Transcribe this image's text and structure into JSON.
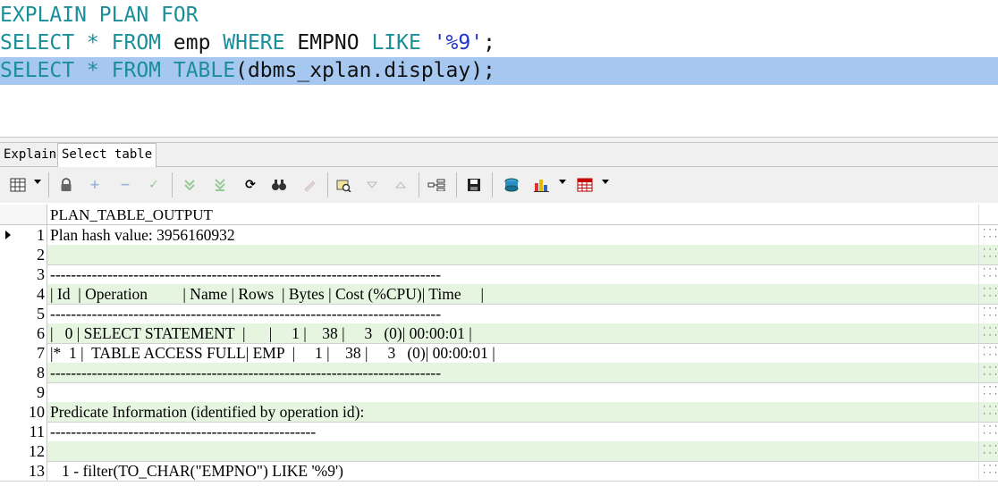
{
  "editor": {
    "lines": [
      {
        "segments": [
          {
            "t": "EXPLAIN PLAN FOR",
            "c": "kw"
          }
        ]
      },
      {
        "segments": [
          {
            "t": "SELECT * FROM ",
            "c": "kw"
          },
          {
            "t": "emp ",
            "c": "id"
          },
          {
            "t": "WHERE ",
            "c": "kw"
          },
          {
            "t": "EMPNO ",
            "c": "id"
          },
          {
            "t": "LIKE ",
            "c": "kw"
          },
          {
            "t": "'%9'",
            "c": "str"
          },
          {
            "t": ";",
            "c": "id"
          }
        ]
      },
      {
        "segments": [
          {
            "t": "SELECT * FROM TABLE",
            "c": "kw"
          },
          {
            "t": "(dbms_xplan.display);",
            "c": "id"
          }
        ],
        "selected": true
      }
    ]
  },
  "tabs": [
    {
      "label": "Explain",
      "active": false
    },
    {
      "label": "Select table",
      "active": true
    }
  ],
  "toolbar": {
    "icons": [
      "grid-view-icon",
      "lock-icon",
      "add-record-icon",
      "delete-record-icon",
      "post-changes-icon",
      "fetch-next-page-icon",
      "fetch-last-page-icon",
      "refresh-icon",
      "find-icon",
      "clear-icon",
      "query-by-example-icon",
      "filter-icon",
      "sort-icon",
      "single-record-view-icon",
      "save-icon",
      "export-icon",
      "chart-icon",
      "export-grid-icon"
    ]
  },
  "grid": {
    "column_header": "PLAN_TABLE_OUTPUT",
    "current_row": 1,
    "rows": [
      {
        "n": "1",
        "text": "Plan hash value: 3956160932"
      },
      {
        "n": "2",
        "text": ""
      },
      {
        "n": "3",
        "text": "---------------------------------------------------------------------------"
      },
      {
        "n": "4",
        "text": "| Id  | Operation         | Name | Rows  | Bytes | Cost (%CPU)| Time     |"
      },
      {
        "n": "5",
        "text": "---------------------------------------------------------------------------"
      },
      {
        "n": "6",
        "text": "|   0 | SELECT STATEMENT  |      |     1 |    38 |     3   (0)| 00:00:01 |"
      },
      {
        "n": "7",
        "text": "|*  1 |  TABLE ACCESS FULL| EMP  |     1 |    38 |     3   (0)| 00:00:01 |"
      },
      {
        "n": "8",
        "text": "---------------------------------------------------------------------------"
      },
      {
        "n": "9",
        "text": ""
      },
      {
        "n": "10",
        "text": "Predicate Information (identified by operation id):"
      },
      {
        "n": "11",
        "text": "---------------------------------------------------"
      },
      {
        "n": "12",
        "text": ""
      },
      {
        "n": "13",
        "text": "   1 - filter(TO_CHAR(\"EMPNO\") LIKE '%9')"
      }
    ]
  }
}
